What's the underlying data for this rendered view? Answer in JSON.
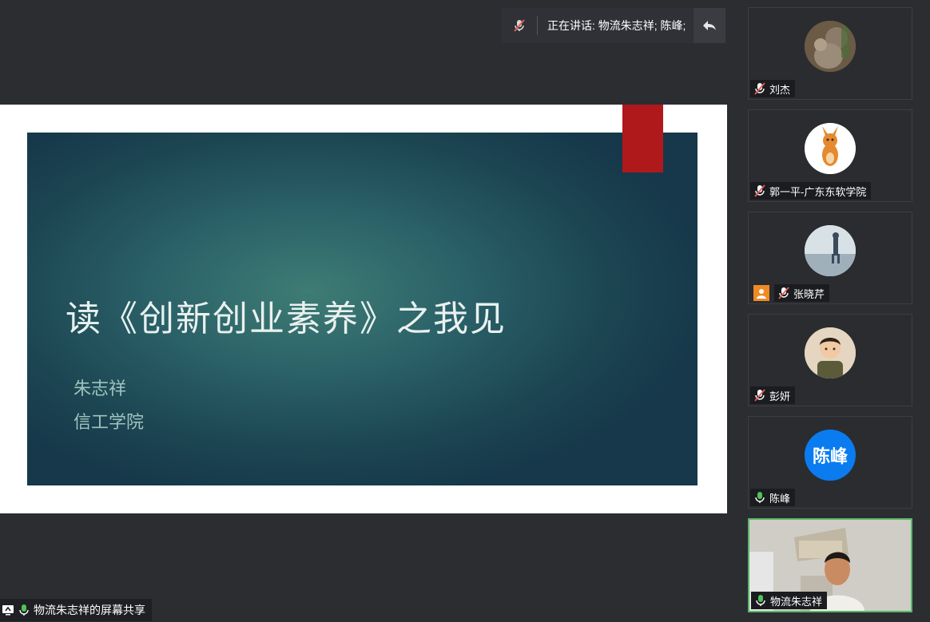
{
  "header": {
    "speaking_label": "正在讲话: 物流朱志祥; 陈峰;"
  },
  "slide": {
    "title": "读《创新创业素养》之我见",
    "author": "朱志祥",
    "department": "信工学院"
  },
  "share": {
    "label": "物流朱志祥的屏幕共享"
  },
  "participants": [
    {
      "name": "刘杰",
      "mic": "muted"
    },
    {
      "name": "郭一平-广东东软学院",
      "mic": "muted"
    },
    {
      "name": "张晓芹",
      "mic": "muted",
      "host_badge": true
    },
    {
      "name": "彭妍",
      "mic": "muted"
    },
    {
      "name": "陈峰",
      "mic": "on",
      "avatar_text": "陈峰",
      "avatar_color": "#0a7cf0"
    },
    {
      "name": "物流朱志祥",
      "mic": "on",
      "active": true
    }
  ],
  "colors": {
    "accent_active": "#56b868",
    "mic_on": "#4fc35a",
    "mic_muted": "#e05a5a",
    "slide_red": "#b0191b"
  }
}
